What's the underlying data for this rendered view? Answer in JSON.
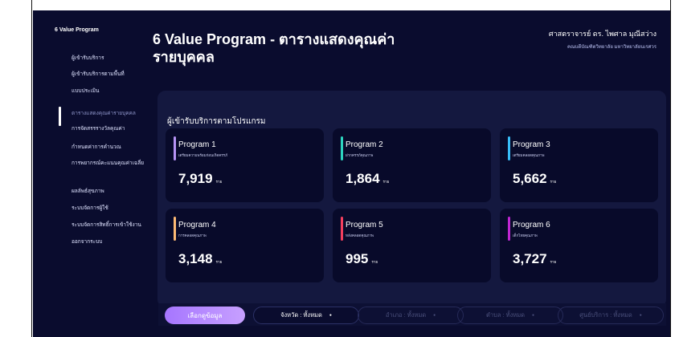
{
  "app": {
    "brand": "6 Value Program"
  },
  "sidebar": {
    "items": [
      {
        "label": "ผู้เข้ารับบริการ"
      },
      {
        "label": "ผู้เข้ารับบริการตามพื้นที่"
      },
      {
        "label": "แบบประเมิน"
      },
      {
        "label": "ตารางแสดงคุณค่ารายบุคคล"
      },
      {
        "label": "การจัดสรรรางวัลคุณค่า"
      },
      {
        "label": "กำหนดค่าการคำนวณ"
      },
      {
        "label": "การพยากรณ์คะแนนคุณค่าเฉลี่ย"
      },
      {
        "label": "ผลลัพธ์สุขภาพ"
      },
      {
        "label": "ระบบจัดการผู้ใช้"
      },
      {
        "label": "ระบบจัดการสิทธิ์การเข้าใช้งาน"
      },
      {
        "label": "ออกจากระบบ"
      }
    ]
  },
  "header": {
    "title": "6 Value Program - ตารางแสดงคุณค่ารายบุคคล",
    "user_name": "ศาสตราจารย์ ดร. ไพศาล มุณีสว่าง",
    "organization": "คณบดีบัณฑิตวิทยาลัย มหาวิทยาลัยนเรศวร"
  },
  "panel": {
    "title": "ผู้เข้ารับบริการตามโปรแกรม",
    "cards": [
      {
        "name": "Program 1",
        "subtitle": "เตรียมความพร้อมก่อนเกิดครรภ์",
        "value": "7,919",
        "unit": "ราย",
        "color": "#b794f6"
      },
      {
        "name": "Program 2",
        "subtitle": "ฝากครรภ์คุณภาพ",
        "value": "1,864",
        "unit": "ราย",
        "color": "#2dd4bf"
      },
      {
        "name": "Program 3",
        "subtitle": "เตรียมคลอดคุณภาพ",
        "value": "5,662",
        "unit": "ราย",
        "color": "#38bdf8"
      },
      {
        "name": "Program 4",
        "subtitle": "การคลอดคุณภาพ",
        "value": "3,148",
        "unit": "ราย",
        "color": "#fdba74"
      },
      {
        "name": "Program 5",
        "subtitle": "หลังคลอดคุณภาพ",
        "value": "995",
        "unit": "ราย",
        "color": "#f43f5e"
      },
      {
        "name": "Program 6",
        "subtitle": "เด็กไทยคุณภาพ",
        "value": "3,727",
        "unit": "ราย",
        "color": "#c026d3"
      }
    ]
  },
  "filters": {
    "select_button": "เลือกดูข้อมูล",
    "province": "จังหวัด : ทั้งหมด",
    "district": "อำเภอ : ทั้งหมด",
    "subdistrict": "ตำบล : ทั้งหมด",
    "service_center": "ศูนย์บริการ : ทั้งหมด"
  }
}
